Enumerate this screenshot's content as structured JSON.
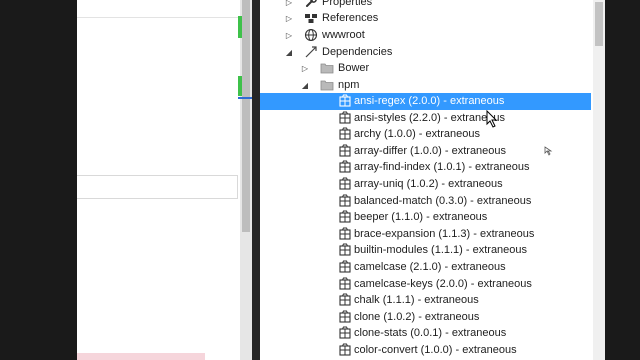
{
  "tree": {
    "top_items": [
      {
        "label": "Properties",
        "icon": "wrench-icon"
      },
      {
        "label": "References",
        "icon": "references-icon"
      },
      {
        "label": "wwwroot",
        "icon": "globe-icon"
      },
      {
        "label": "Dependencies",
        "icon": "dependencies-icon"
      },
      {
        "label": "Bower",
        "icon": "folder-icon"
      },
      {
        "label": "npm",
        "icon": "folder-icon"
      }
    ],
    "packages": [
      "ansi-regex (2.0.0) - extraneous",
      "ansi-styles (2.2.0) - extraneous",
      "archy (1.0.0) - extraneous",
      "array-differ (1.0.0) - extraneous",
      "array-find-index (1.0.1) - extraneous",
      "array-uniq (1.0.2) - extraneous",
      "balanced-match (0.3.0) - extraneous",
      "beeper (1.1.0) - extraneous",
      "brace-expansion (1.1.3) - extraneous",
      "builtin-modules (1.1.1) - extraneous",
      "camelcase (2.1.0) - extraneous",
      "camelcase-keys (2.0.0) - extraneous",
      "chalk (1.1.1) - extraneous",
      "clone (1.0.2) - extraneous",
      "clone-stats (0.0.1) - extraneous",
      "color-convert (1.0.0) - extraneous"
    ],
    "selected_index": 0
  },
  "colors": {
    "selection": "#3399ff",
    "change_marker": "#3ec14a",
    "caret_marker": "#2d6bd4"
  }
}
